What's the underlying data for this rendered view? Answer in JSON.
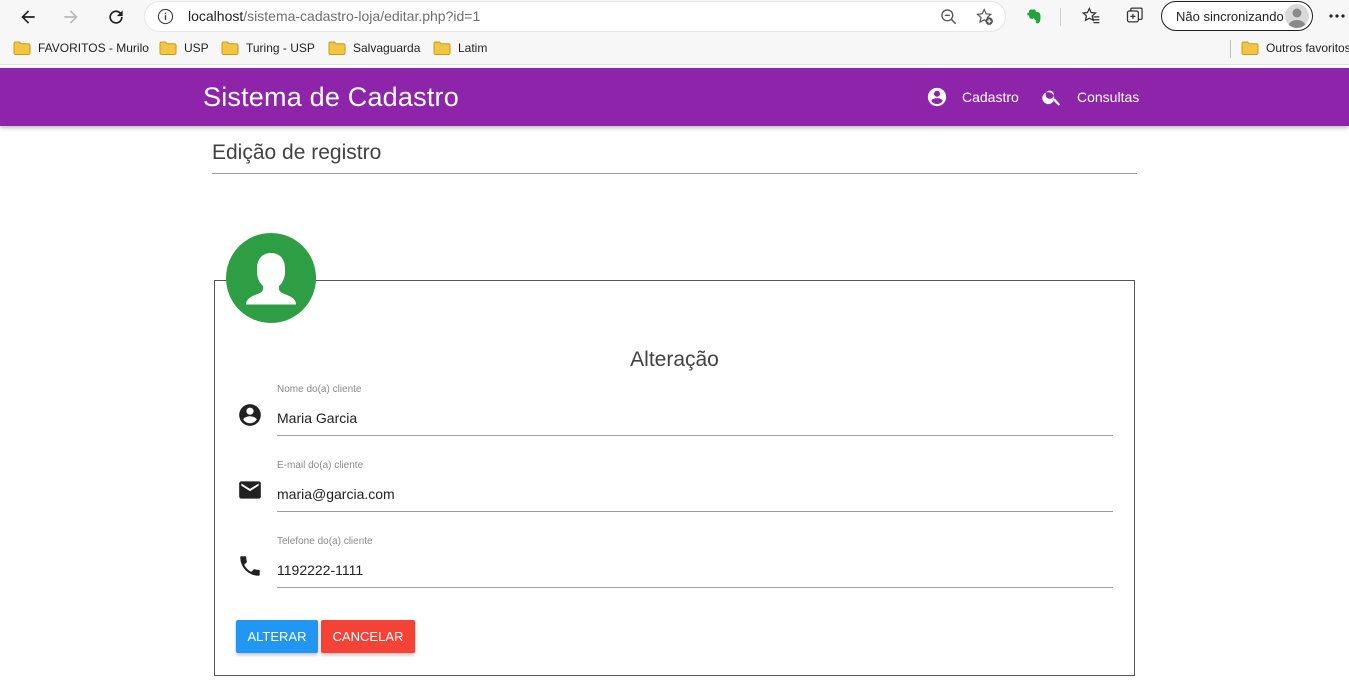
{
  "browser": {
    "url_host": "localhost",
    "url_path": "/sistema-cadastro-loja/editar.php?id=1",
    "sync_label": "Não sincronizando",
    "bookmarks": [
      "FAVORITOS - Murilo",
      "USP",
      "Turing - USP",
      "Salvaguarda",
      "Latim"
    ],
    "other_favorites": "Outros favoritos",
    "colors": {
      "extension_green": "#1fa33a",
      "folder_yellow": "#f4c542"
    }
  },
  "header": {
    "brand": "Sistema de Cadastro",
    "nav": [
      {
        "label": "Cadastro",
        "icon": "account-circle-icon"
      },
      {
        "label": "Consultas",
        "icon": "search-icon"
      }
    ],
    "color": "#8e24aa"
  },
  "page": {
    "title": "Edição de registro"
  },
  "form": {
    "title": "Alteração",
    "avatar_color": "#2e9e44",
    "fields": [
      {
        "label": "Nome do(a) cliente",
        "value": "Maria Garcia",
        "icon": "account-circle-icon"
      },
      {
        "label": "E-mail do(a) cliente",
        "value": "maria@garcia.com",
        "icon": "email-icon"
      },
      {
        "label": "Telefone do(a) cliente",
        "value": "1192222-1111",
        "icon": "phone-icon"
      }
    ],
    "buttons": {
      "submit": {
        "label": "Alterar",
        "color": "#2196f3"
      },
      "cancel": {
        "label": "Cancelar",
        "color": "#f44336"
      }
    }
  }
}
